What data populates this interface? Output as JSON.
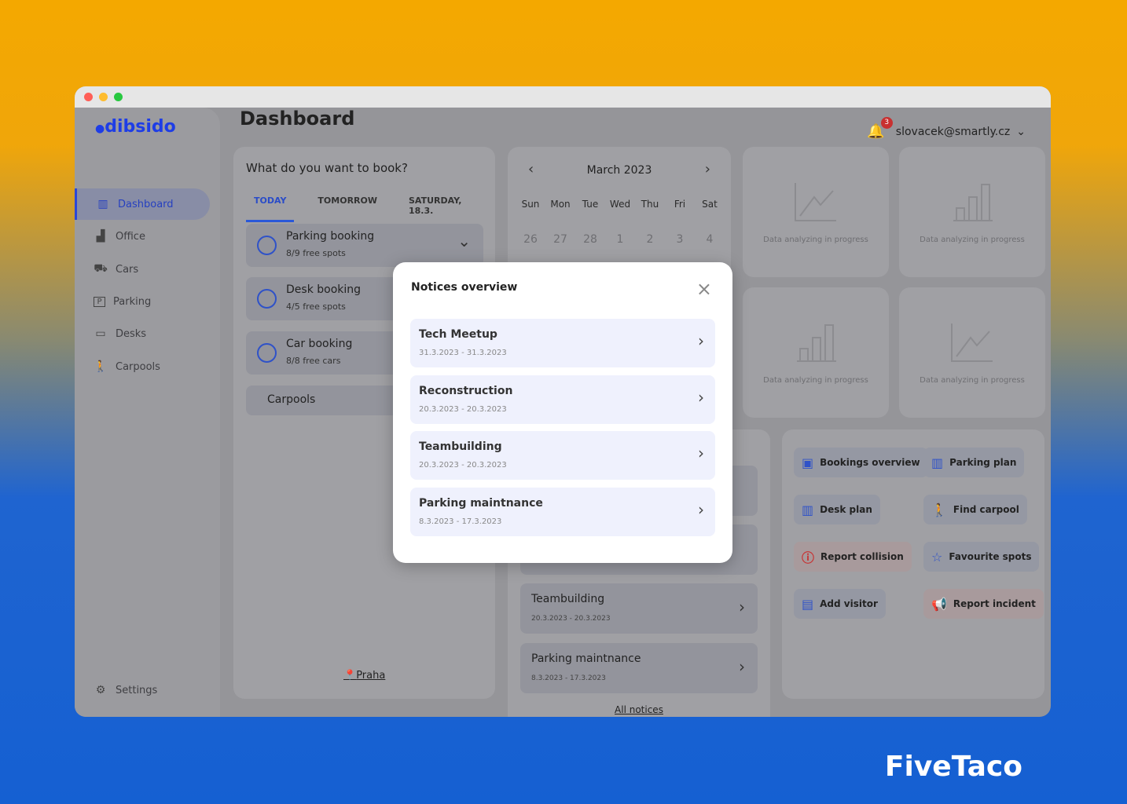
{
  "window": {
    "traffic_colors": [
      "#ff5f57",
      "#febc2e",
      "#28c840"
    ]
  },
  "sidebar": {
    "logo": "dibsido",
    "items": [
      {
        "label": "Dashboard",
        "icon": "dashboard-icon",
        "glyph": "▥"
      },
      {
        "label": "Office",
        "icon": "office-building-icon",
        "glyph": "▟"
      },
      {
        "label": "Cars",
        "icon": "car-icon",
        "glyph": "⛟"
      },
      {
        "label": "Parking",
        "icon": "parking-icon",
        "glyph": "🅿"
      },
      {
        "label": "Desks",
        "icon": "desk-monitor-icon",
        "glyph": "▭"
      },
      {
        "label": "Carpools",
        "icon": "carpool-person-icon",
        "glyph": "🚶"
      }
    ],
    "settings": "Settings"
  },
  "header": {
    "title": "Dashboard",
    "notifications": "3",
    "user": "slovacek@smartly.cz"
  },
  "booking": {
    "question": "What do you want to book?",
    "tabs": [
      "TODAY",
      "TOMORROW",
      "SATURDAY, 18.3."
    ],
    "items": [
      {
        "name": "Parking booking",
        "sub": "8/9 free spots"
      },
      {
        "name": "Desk booking",
        "sub": "4/5 free spots"
      },
      {
        "name": "Car booking",
        "sub": "8/8 free cars"
      }
    ],
    "carpools": "Carpools",
    "location": "Praha"
  },
  "calendar": {
    "month": "March 2023",
    "weekdays": [
      "Sun",
      "Mon",
      "Tue",
      "Wed",
      "Thu",
      "Fri",
      "Sat"
    ],
    "days": [
      "26",
      "27",
      "28",
      "1",
      "2",
      "3",
      "4"
    ]
  },
  "stats": [
    "Data analyzing in progress",
    "Data analyzing in progress",
    "Data analyzing in progress",
    "Data analyzing in progress"
  ],
  "notices": {
    "items": [
      {
        "title": "Teambuilding",
        "dates": "20.3.2023 - 20.3.2023"
      },
      {
        "title": "Parking maintnance",
        "dates": "8.3.2023 - 17.3.2023"
      }
    ],
    "all": "All notices"
  },
  "quick_actions": [
    {
      "label": "Bookings overview",
      "icon": "calendar-check-icon"
    },
    {
      "label": "Parking plan",
      "icon": "map-icon"
    },
    {
      "label": "Desk plan",
      "icon": "map-icon"
    },
    {
      "label": "Find carpool",
      "icon": "carpool-person-icon"
    },
    {
      "label": "Report collision",
      "icon": "alert-circle-icon"
    },
    {
      "label": "Favourite spots",
      "icon": "star-icon"
    },
    {
      "label": "Add visitor",
      "icon": "visitor-badge-icon"
    },
    {
      "label": "Report incident",
      "icon": "megaphone-icon"
    }
  ],
  "modal": {
    "title": "Notices overview",
    "items": [
      {
        "title": "Tech Meetup",
        "dates": "31.3.2023 - 31.3.2023"
      },
      {
        "title": "Reconstruction",
        "dates": "20.3.2023 - 20.3.2023"
      },
      {
        "title": "Teambuilding",
        "dates": "20.3.2023 - 20.3.2023"
      },
      {
        "title": "Parking maintnance",
        "dates": "8.3.2023 - 17.3.2023"
      }
    ]
  },
  "brand": "FiveTaco"
}
